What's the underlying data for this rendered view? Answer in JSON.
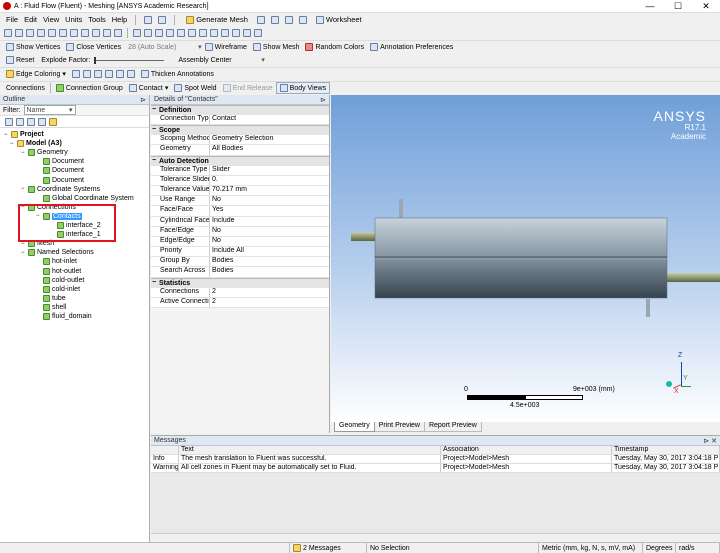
{
  "window": {
    "title": "A : Fluid Flow (Fluent) - Meshing [ANSYS Academic Research]"
  },
  "menu": [
    "File",
    "Edit",
    "View",
    "Units",
    "Tools",
    "Help"
  ],
  "toolbar1": {
    "generate_mesh": "Generate Mesh",
    "worksheet": "Worksheet"
  },
  "toolbar3": {
    "show_vertices": "Show Vertices",
    "close_vertices": "Close Vertices",
    "auto_scale": "28 (Auto Scale)",
    "wireframe": "Wireframe",
    "show_mesh": "Show Mesh",
    "random_colors": "Random Colors",
    "annotation_prefs": "Annotation Preferences"
  },
  "toolbar4": {
    "reset": "Reset",
    "explode_factor": "Explode Factor:",
    "assembly_center": "Assembly Center"
  },
  "toolbar5": {
    "edge_coloring": "Edge Coloring",
    "thicken": "Thicken Annotations"
  },
  "toolbar6": {
    "connections": "Connections",
    "connection_group": "Connection Group",
    "contact": "Contact",
    "spot_weld": "Spot Weld",
    "end_release": "End Release",
    "body_views": "Body Views"
  },
  "outline": {
    "title": "Outline",
    "filter_label": "Filter:",
    "filter_value": "Name",
    "tree": [
      {
        "label": "Project",
        "level": 0,
        "bold": true
      },
      {
        "label": "Model (A3)",
        "level": 1,
        "bold": true
      },
      {
        "label": "Geometry",
        "level": 2
      },
      {
        "label": "Document",
        "level": 3
      },
      {
        "label": "Document",
        "level": 3
      },
      {
        "label": "Document",
        "level": 3
      },
      {
        "label": "Coordinate Systems",
        "level": 2
      },
      {
        "label": "Global Coordinate System",
        "level": 3
      },
      {
        "label": "Connections",
        "level": 2
      },
      {
        "label": "Contacts",
        "level": 3,
        "selected": true
      },
      {
        "label": "interface_2",
        "level": 4
      },
      {
        "label": "interface_1",
        "level": 4
      },
      {
        "label": "Mesh",
        "level": 2
      },
      {
        "label": "Named Selections",
        "level": 2
      },
      {
        "label": "hot-inlet",
        "level": 3
      },
      {
        "label": "hot-outlet",
        "level": 3
      },
      {
        "label": "cold-outlet",
        "level": 3
      },
      {
        "label": "cold-inlet",
        "level": 3
      },
      {
        "label": "tube",
        "level": 3
      },
      {
        "label": "shell",
        "level": 3
      },
      {
        "label": "fluid_domain",
        "level": 3
      }
    ]
  },
  "details": {
    "title": "Details of \"Contacts\"",
    "sections": [
      {
        "name": "Definition",
        "rows": [
          [
            "Connection Type",
            "Contact"
          ]
        ]
      },
      {
        "name": "Scope",
        "rows": [
          [
            "Scoping Method",
            "Geometry Selection"
          ],
          [
            "Geometry",
            "All Bodies"
          ]
        ]
      },
      {
        "name": "Auto Detection",
        "rows": [
          [
            "Tolerance Type",
            "Slider"
          ],
          [
            "Tolerance Slider",
            "0."
          ],
          [
            "Tolerance Value",
            "70.217 mm"
          ],
          [
            "Use Range",
            "No"
          ],
          [
            "Face/Face",
            "Yes"
          ],
          [
            "Cylindrical Faces",
            "Include"
          ],
          [
            "Face/Edge",
            "No"
          ],
          [
            "Edge/Edge",
            "No"
          ],
          [
            "Priority",
            "Include All"
          ],
          [
            "Group By",
            "Bodies"
          ],
          [
            "Search Across",
            "Bodies"
          ]
        ]
      },
      {
        "name": "Statistics",
        "rows": [
          [
            "Connections",
            "2"
          ],
          [
            "Active Connections",
            "2"
          ]
        ]
      }
    ]
  },
  "viewport": {
    "brand": "ANSYS",
    "version": "R17.1",
    "edition": "Academic",
    "scale_zero": "0",
    "scale_max": "9e+003 (mm)",
    "scale_mid": "4.5e+003",
    "tabs": [
      "Geometry",
      "Print Preview",
      "Report Preview"
    ],
    "axis_x": "X",
    "axis_y": "Y",
    "axis_z": "Z"
  },
  "messages": {
    "title": "Messages",
    "headers": [
      "Text",
      "Association",
      "Timestamp"
    ],
    "rows": [
      [
        "Info",
        "The mesh translation to Fluent was successful.",
        "Project>Model>Mesh",
        "Tuesday, May 30, 2017 3:04:18 P"
      ],
      [
        "Warning",
        "All cell zones in Fluent may be automatically set to Fluid.",
        "Project>Model>Mesh",
        "Tuesday, May 30, 2017 3:04:18 P"
      ]
    ]
  },
  "status": {
    "messages": "2 Messages",
    "selection": "No Selection",
    "units": "Metric (mm, kg, N, s, mV, mA)",
    "degrees": "Degrees",
    "rads": "rad/s"
  },
  "colors": {
    "accent": "#3399ff",
    "highlight": "#e0141e",
    "viewport_top": "#6f9fd8",
    "viewport_bottom": "#ffffff"
  }
}
